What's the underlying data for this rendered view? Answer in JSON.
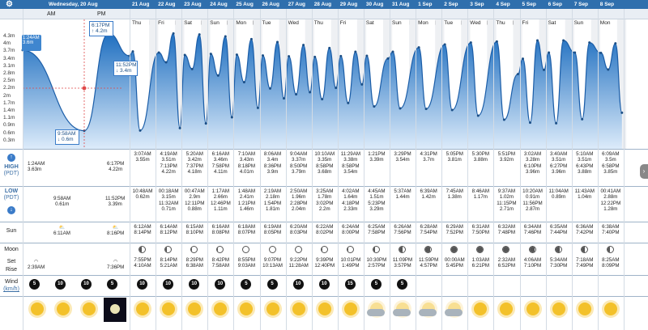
{
  "header": {
    "current_date": "Wednesday, 20 Aug",
    "am_label": "AM",
    "pm_label": "PM",
    "dates": [
      "21 Aug",
      "22 Aug",
      "23 Aug",
      "24 Aug",
      "25 Aug",
      "26 Aug",
      "27 Aug",
      "28 Aug",
      "29 Aug",
      "30 Aug",
      "31 Aug",
      "1 Sep",
      "2 Sep",
      "3 Sep",
      "4 Sep",
      "5 Sep",
      "6 Sep",
      "7 Sep",
      "8 Sep"
    ],
    "days": [
      "Thu",
      "Fri",
      "Sat",
      "Sun",
      "Mon",
      "Tue",
      "Wed",
      "Thu",
      "Fri",
      "Sat",
      "Sun",
      "Mon",
      "Tue",
      "Wed",
      "Thu",
      "Fri",
      "Sat",
      "Sun",
      "Mon"
    ]
  },
  "y_axis": [
    "4.3m",
    "4m",
    "3.7m",
    "3.4m",
    "3.1m",
    "2.8m",
    "2.5m",
    "2.2m",
    "2m",
    "1.7m",
    "1.4m",
    "1.1m",
    "0.9m",
    "0.6m",
    "0.3m"
  ],
  "callouts": [
    {
      "time": "1:24AM",
      "height": "3.6m"
    },
    {
      "time": "6:17PM",
      "height": "↑ 4.2m"
    },
    {
      "time": "11:52PM",
      "height": "↓ 3.4m"
    },
    {
      "time": "9:58AM",
      "height": "↓ 0.6m"
    }
  ],
  "labels": {
    "high": "HIGH",
    "high_tz": "(PDT)",
    "low": "LOW",
    "low_tz": "(PDT)",
    "sun": "Sun",
    "moon": "Moon",
    "set": "Set",
    "rise": "Rise",
    "wind": "Wind",
    "wind_unit": "(km/h)"
  },
  "today": {
    "high": [
      {
        "time": "1:24AM",
        "h": "3.63m"
      },
      {
        "time": "6:17PM",
        "h": "4.22m"
      }
    ],
    "low": [
      {
        "time": "9:58AM",
        "h": "0.61m"
      },
      {
        "time": "11:52PM",
        "h": "3.39m"
      }
    ],
    "sunrise": "6:11AM",
    "sunset": "8:16PM",
    "moonrise": "2:39AM",
    "moonset": "7:36PM"
  },
  "highs": [
    [
      "3:07AM",
      "3.55m",
      "",
      ""
    ],
    [
      "4:19AM",
      "3.51m",
      "7:13PM",
      "4.22m"
    ],
    [
      "5:20AM",
      "3.42m",
      "7:37PM",
      "4.18m"
    ],
    [
      "6:16AM",
      "3.46m",
      "7:58PM",
      "4.11m"
    ],
    [
      "7:10AM",
      "3.43m",
      "8:18PM",
      "4.01m"
    ],
    [
      "8:06AM",
      "3.4m",
      "8:36PM",
      "3.9m"
    ],
    [
      "9:04AM",
      "3.37m",
      "8:50PM",
      "3.79m"
    ],
    [
      "10:10AM",
      "3.35m",
      "8:58PM",
      "3.68m"
    ],
    [
      "11:29AM",
      "3.38m",
      "8:58PM",
      "3.54m"
    ],
    [
      "1:21PM",
      "3.39m",
      "",
      ""
    ],
    [
      "3:29PM",
      "3.54m",
      "",
      ""
    ],
    [
      "4:31PM",
      "3.7m",
      "",
      ""
    ],
    [
      "5:05PM",
      "3.81m",
      "",
      ""
    ],
    [
      "5:30PM",
      "3.88m",
      "",
      ""
    ],
    [
      "5:51PM",
      "3.92m",
      "",
      ""
    ],
    [
      "3:02AM",
      "3.28m",
      "6:10PM",
      "3.96m"
    ],
    [
      "3:40AM",
      "3.51m",
      "6:27PM",
      "3.96m"
    ],
    [
      "5:10AM",
      "3.51m",
      "6:43PM",
      "3.88m"
    ],
    [
      "6:09AM",
      "3.5m",
      "6:58PM",
      "3.85m"
    ]
  ],
  "lows": [
    [
      "10:48AM",
      "0.62m",
      "",
      ""
    ],
    [
      "00:18AM",
      "3.15m",
      "11:32AM",
      "0.71m"
    ],
    [
      "00:47AM",
      "2.9m",
      "12:11PM",
      "0.88m"
    ],
    [
      "1:17AM",
      "2.66m",
      "12:46PM",
      "1.11m"
    ],
    [
      "1:48AM",
      "2.41m",
      "1:21PM",
      "1.46m"
    ],
    [
      "2:19AM",
      "2.18m",
      "1:54PM",
      "1.81m"
    ],
    [
      "2:50AM",
      "1.96m",
      "2:28PM",
      "2.04m"
    ],
    [
      "3:25AM",
      "1.78m",
      "3:02PM",
      "2.2m"
    ],
    [
      "4:02AM",
      "1.64m",
      "4:18PM",
      "2.33m"
    ],
    [
      "4:45AM",
      "1.51m",
      "5:23PM",
      "3.29m"
    ],
    [
      "5:37AM",
      "1.44m",
      "",
      ""
    ],
    [
      "6:39AM",
      "1.42m",
      "",
      ""
    ],
    [
      "7:45AM",
      "1.38m",
      "",
      ""
    ],
    [
      "8:46AM",
      "1.17m",
      "",
      ""
    ],
    [
      "9:37AM",
      "1.02m",
      "11:15PM",
      "2.71m"
    ],
    [
      "10:20AM",
      "0.91m",
      "11:56PM",
      "2.87m"
    ],
    [
      "11:04AM",
      "0.89m",
      "",
      ""
    ],
    [
      "11:43AM",
      "1.04m",
      "",
      ""
    ],
    [
      "00:41AM",
      "2.88m",
      "12:22PM",
      "1.28m"
    ]
  ],
  "sunrise": [
    "6:12AM",
    "6:14AM",
    "6:15AM",
    "6:16AM",
    "6:18AM",
    "6:19AM",
    "6:20AM",
    "6:22AM",
    "6:24AM",
    "6:25AM",
    "6:26AM",
    "6:28AM",
    "6:29AM",
    "6:31AM",
    "6:32AM",
    "6:34AM",
    "6:35AM",
    "6:36AM",
    "6:38AM"
  ],
  "sunset": [
    "8:14PM",
    "8:12PM",
    "8:10PM",
    "8:08PM",
    "8:07PM",
    "8:05PM",
    "8:03PM",
    "8:02PM",
    "8:00PM",
    "7:58PM",
    "7:56PM",
    "7:54PM",
    "7:52PM",
    "7:50PM",
    "7:48PM",
    "7:46PM",
    "7:44PM",
    "7:42PM",
    "7:40PM"
  ],
  "moonset": [
    "7:55PM",
    "8:14PM",
    "8:29PM",
    "8:42PM",
    "8:55PM",
    "9:07PM",
    "9:22PM",
    "9:39PM",
    "10:01PM",
    "10:30PM",
    "11:09PM",
    "11:59PM",
    "00:00AM",
    "1:03AM",
    "2:32AM",
    "4:06AM",
    "5:34AM",
    "7:18AM",
    "8:25AM"
  ],
  "moonrise": [
    "4:10AM",
    "5:21AM",
    "6:38AM",
    "7:58AM",
    "9:03AM",
    "10:13AM",
    "11:28AM",
    "12:40PM",
    "1:49PM",
    "2:57PM",
    "3:57PM",
    "4:57PM",
    "5:45PM",
    "6:21PM",
    "6:52PM",
    "7:10PM",
    "7:30PM",
    "7:49PM",
    "8:09PM"
  ],
  "wind": {
    "today": [
      "5",
      "10",
      "10",
      "5"
    ],
    "days": [
      "10",
      "10",
      "10",
      "10",
      "5",
      "5",
      "10",
      "10",
      "15",
      "5",
      "5",
      "",
      ""
    ]
  }
}
